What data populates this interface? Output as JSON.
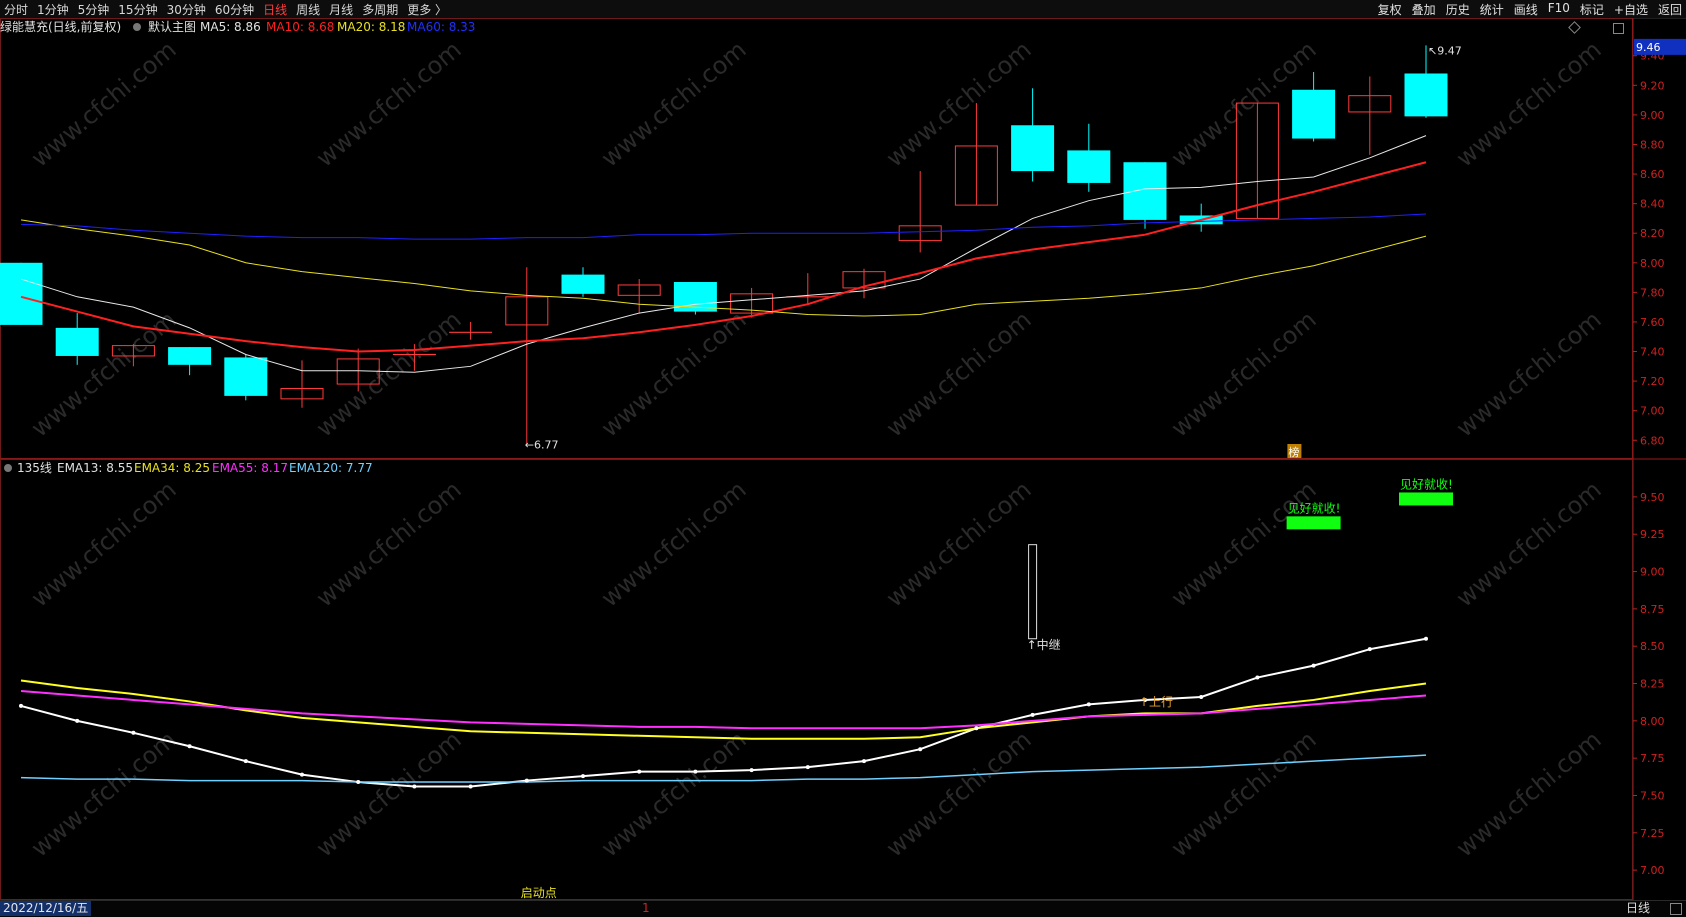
{
  "toolbar": {
    "left": [
      "分时",
      "1分钟",
      "5分钟",
      "15分钟",
      "30分钟",
      "60分钟",
      "日线",
      "周线",
      "月线",
      "多周期",
      "更多 〉"
    ],
    "active": "日线",
    "right": [
      "复权",
      "叠加",
      "历史",
      "统计",
      "画线",
      "F10",
      "标记",
      "+自选",
      "返回"
    ]
  },
  "bottom": {
    "date": "2022/12/16/五",
    "period": "日线",
    "cursor_mark": "1"
  },
  "colors": {
    "up": "#ff3b3b",
    "down": "#00ffff",
    "ma5": "#e8e8e8",
    "ma10": "#ff2020",
    "ma20": "#e8e020",
    "ma60": "#2020ff",
    "ema13": "#ffffff",
    "ema34": "#ffff20",
    "ema55": "#ff30ff",
    "ema120": "#70d0ff",
    "signal_green": "#10ff10"
  },
  "chart_data": [
    {
      "type": "candlestick",
      "title": "绿能慧充(日线,前复权)",
      "template": "默认主图",
      "legend": [
        {
          "name": "MA5",
          "value": "8.86"
        },
        {
          "name": "MA10",
          "value": "8.68"
        },
        {
          "name": "MA20",
          "value": "8.18"
        },
        {
          "name": "MA60",
          "value": "8.33"
        }
      ],
      "yticks": [
        6.8,
        7.0,
        7.2,
        7.4,
        7.6,
        7.8,
        8.0,
        8.2,
        8.4,
        8.6,
        8.8,
        9.0,
        9.2,
        9.4
      ],
      "ylim": [
        6.68,
        9.52
      ],
      "current_price": "9.46",
      "high_label": "9.47",
      "low_label": "6.77",
      "marker": "榜",
      "candles": [
        {
          "o": 8.0,
          "h": 8.0,
          "l": 7.58,
          "c": 7.58
        },
        {
          "o": 7.56,
          "h": 7.66,
          "l": 7.31,
          "c": 7.37
        },
        {
          "o": 7.37,
          "h": 7.45,
          "l": 7.3,
          "c": 7.44
        },
        {
          "o": 7.43,
          "h": 7.43,
          "l": 7.24,
          "c": 7.31
        },
        {
          "o": 7.36,
          "h": 7.38,
          "l": 7.07,
          "c": 7.1
        },
        {
          "o": 7.08,
          "h": 7.34,
          "l": 7.02,
          "c": 7.15
        },
        {
          "o": 7.18,
          "h": 7.42,
          "l": 7.13,
          "c": 7.35
        },
        {
          "o": 7.38,
          "h": 7.45,
          "l": 7.27,
          "c": 7.38
        },
        {
          "o": 7.53,
          "h": 7.6,
          "l": 7.48,
          "c": 7.53
        },
        {
          "o": 7.58,
          "h": 7.97,
          "l": 6.77,
          "c": 7.77
        },
        {
          "o": 7.92,
          "h": 7.97,
          "l": 7.77,
          "c": 7.79
        },
        {
          "o": 7.78,
          "h": 7.89,
          "l": 7.66,
          "c": 7.85
        },
        {
          "o": 7.87,
          "h": 7.87,
          "l": 7.65,
          "c": 7.67
        },
        {
          "o": 7.66,
          "h": 7.83,
          "l": 7.63,
          "c": 7.79
        },
        {
          "o": 7.77,
          "h": 7.93,
          "l": 7.72,
          "c": 7.77
        },
        {
          "o": 7.83,
          "h": 7.96,
          "l": 7.76,
          "c": 7.94
        },
        {
          "o": 8.15,
          "h": 8.62,
          "l": 8.07,
          "c": 8.25
        },
        {
          "o": 8.39,
          "h": 9.08,
          "l": 8.39,
          "c": 8.79
        },
        {
          "o": 8.93,
          "h": 9.18,
          "l": 8.55,
          "c": 8.62
        },
        {
          "o": 8.76,
          "h": 8.94,
          "l": 8.48,
          "c": 8.54
        },
        {
          "o": 8.68,
          "h": 8.68,
          "l": 8.23,
          "c": 8.29
        },
        {
          "o": 8.32,
          "h": 8.4,
          "l": 8.21,
          "c": 8.26
        },
        {
          "o": 8.3,
          "h": 9.08,
          "l": 8.3,
          "c": 9.08
        },
        {
          "o": 9.17,
          "h": 9.29,
          "l": 8.82,
          "c": 8.84
        },
        {
          "o": 9.02,
          "h": 9.26,
          "l": 8.73,
          "c": 9.13
        },
        {
          "o": 9.28,
          "h": 9.47,
          "l": 8.98,
          "c": 8.99
        }
      ],
      "series": [
        {
          "name": "MA5",
          "values": [
            7.89,
            7.77,
            7.7,
            7.56,
            7.38,
            7.27,
            7.27,
            7.26,
            7.3,
            7.45,
            7.56,
            7.66,
            7.72,
            7.75,
            7.78,
            7.81,
            7.89,
            8.1,
            8.3,
            8.42,
            8.5,
            8.51,
            8.55,
            8.58,
            8.71,
            8.86
          ]
        },
        {
          "name": "MA10",
          "values": [
            8.03,
            7.95,
            7.86,
            7.77,
            7.67,
            7.57,
            7.52,
            7.47,
            7.43,
            7.4,
            7.41,
            7.44,
            7.47,
            7.49,
            7.53,
            7.58,
            7.64,
            7.72,
            7.84,
            7.93,
            8.03,
            8.09,
            8.14,
            8.19,
            8.29,
            8.39,
            8.48,
            8.58,
            8.68
          ]
        },
        {
          "name": "MA20",
          "values": [
            8.29,
            8.23,
            8.18,
            8.12,
            8.0,
            7.94,
            7.9,
            7.86,
            7.81,
            7.78,
            7.76,
            7.72,
            7.7,
            7.68,
            7.65,
            7.64,
            7.65,
            7.72,
            7.74,
            7.76,
            7.79,
            7.83,
            7.91,
            7.98,
            8.08,
            8.18
          ]
        },
        {
          "name": "MA60",
          "values": [
            8.26,
            8.25,
            8.22,
            8.2,
            8.18,
            8.17,
            8.17,
            8.16,
            8.16,
            8.17,
            8.17,
            8.19,
            8.19,
            8.2,
            8.2,
            8.2,
            8.21,
            8.22,
            8.24,
            8.25,
            8.27,
            8.28,
            8.29,
            8.3,
            8.31,
            8.33
          ]
        }
      ]
    },
    {
      "type": "line",
      "title": "135线",
      "legend": [
        {
          "name": "EMA13",
          "value": "8.55"
        },
        {
          "name": "EMA34",
          "value": "8.25"
        },
        {
          "name": "EMA55",
          "value": "8.17"
        },
        {
          "name": "EMA120",
          "value": "7.77"
        }
      ],
      "yticks": [
        7.0,
        7.25,
        7.5,
        7.75,
        8.0,
        8.25,
        8.5,
        8.75,
        9.0,
        9.25,
        9.5
      ],
      "ylim": [
        6.8,
        9.64
      ],
      "series": [
        {
          "name": "EMA13",
          "values": [
            8.1,
            8.0,
            7.92,
            7.83,
            7.73,
            7.64,
            7.59,
            7.56,
            7.56,
            7.6,
            7.63,
            7.66,
            7.66,
            7.67,
            7.69,
            7.73,
            7.81,
            7.95,
            8.04,
            8.11,
            8.14,
            8.16,
            8.29,
            8.37,
            8.48,
            8.55
          ]
        },
        {
          "name": "EMA34",
          "values": [
            8.27,
            8.22,
            8.18,
            8.13,
            8.07,
            8.02,
            7.99,
            7.96,
            7.93,
            7.92,
            7.91,
            7.9,
            7.89,
            7.88,
            7.88,
            7.88,
            7.89,
            7.95,
            7.99,
            8.03,
            8.05,
            8.05,
            8.1,
            8.14,
            8.2,
            8.25
          ]
        },
        {
          "name": "EMA55",
          "values": [
            8.2,
            8.17,
            8.14,
            8.11,
            8.08,
            8.05,
            8.03,
            8.01,
            7.99,
            7.98,
            7.97,
            7.96,
            7.96,
            7.95,
            7.95,
            7.95,
            7.95,
            7.97,
            8.0,
            8.03,
            8.04,
            8.05,
            8.08,
            8.11,
            8.14,
            8.17
          ]
        },
        {
          "name": "EMA120",
          "values": [
            7.62,
            7.61,
            7.61,
            7.6,
            7.6,
            7.6,
            7.59,
            7.59,
            7.59,
            7.59,
            7.6,
            7.6,
            7.6,
            7.6,
            7.61,
            7.61,
            7.62,
            7.64,
            7.66,
            7.67,
            7.68,
            7.69,
            7.71,
            7.73,
            7.75,
            7.77
          ]
        }
      ],
      "annotations": [
        {
          "text": "启动点",
          "index": 9,
          "y": 6.82,
          "color": "#e8e020"
        },
        {
          "text": "↑中继",
          "index": 18,
          "y": 8.48,
          "color": "#e0e0e0"
        },
        {
          "text": "↑上行",
          "index": 20,
          "y": 8.1,
          "color": "#e0a030"
        },
        {
          "text": "见好就收!",
          "index": 23,
          "y": 9.41,
          "color": "#10ff10"
        },
        {
          "text": "见好就收!",
          "index": 25,
          "y": 9.57,
          "color": "#10ff10"
        }
      ],
      "relay_bar": {
        "index": 18,
        "top": 9.18,
        "bottom": 8.55
      }
    }
  ]
}
